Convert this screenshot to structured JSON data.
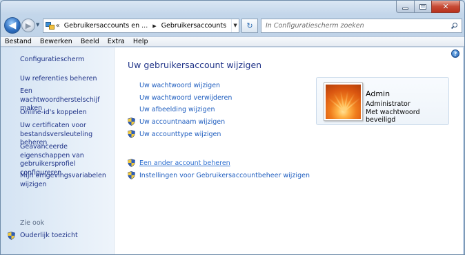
{
  "nav": {
    "breadcrumbs": [
      "Gebruikersaccounts en ...",
      "Gebruikersaccounts"
    ],
    "search_placeholder": "In Configuratiescherm zoeken"
  },
  "menu": [
    "Bestand",
    "Bewerken",
    "Beeld",
    "Extra",
    "Help"
  ],
  "sidebar": {
    "home": "Configuratiescherm",
    "links": [
      "Uw referenties beheren",
      "Een wachtwoordherstelschijf maken",
      "Online-id's koppelen",
      "Uw certificaten voor bestandsversleuteling beheren",
      "Geavanceerde eigenschappen van gebruikersprofiel configureren",
      "Mijn omgevingsvariabelen wijzigen"
    ],
    "see_also": "Zie ook",
    "parental": "Ouderlijk toezicht"
  },
  "main": {
    "title": "Uw gebruikersaccount wijzigen",
    "tasks": [
      "Uw wachtwoord wijzigen",
      "Uw wachtwoord verwijderen",
      "Uw afbeelding wijzigen",
      "Uw accountnaam wijzigen",
      "Uw accounttype wijzigen"
    ],
    "manage_other": "Een ander account beheren",
    "uac_settings": "Instellingen voor Gebruikersaccountbeheer wijzigen"
  },
  "account": {
    "name": "Admin",
    "role": "Administrator",
    "password_status": "Met wachtwoord beveiligd"
  },
  "colors": {
    "link": "#1e5dbf",
    "nav_link": "#1e3287",
    "heading": "#1e3287",
    "sidebar_bg": "#dce9f6"
  }
}
